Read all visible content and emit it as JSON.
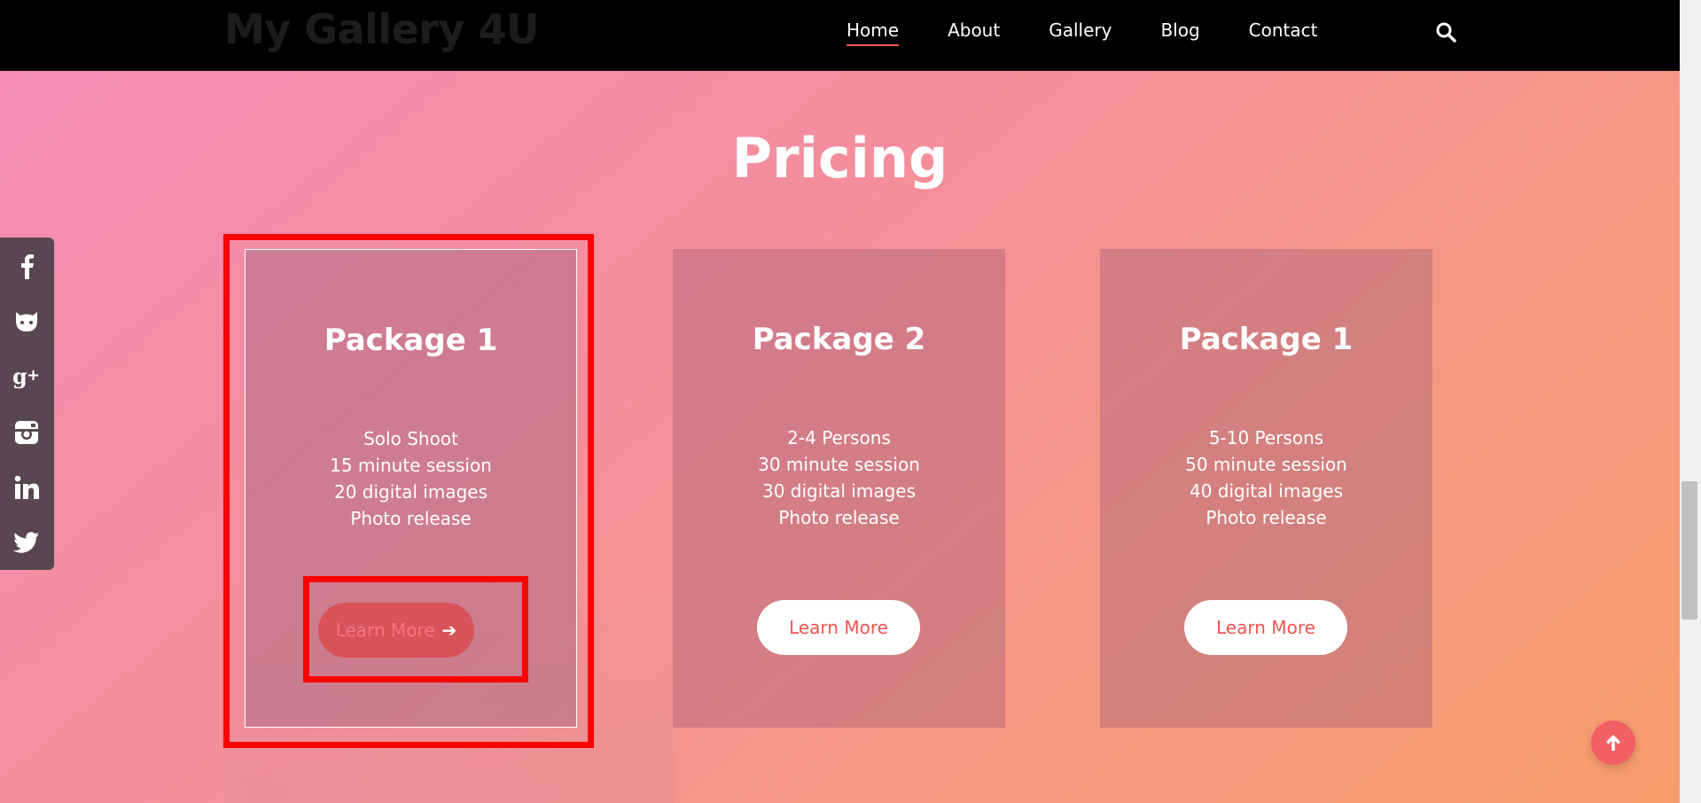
{
  "header": {
    "logo": "My Gallery 4U",
    "nav": [
      {
        "label": "Home",
        "active": true
      },
      {
        "label": "About"
      },
      {
        "label": "Gallery"
      },
      {
        "label": "Blog"
      },
      {
        "label": "Contact"
      }
    ],
    "search_icon": "search-icon"
  },
  "section": {
    "title": "Pricing"
  },
  "social": [
    {
      "icon": "facebook-icon"
    },
    {
      "icon": "github-icon"
    },
    {
      "icon": "google-plus-icon"
    },
    {
      "icon": "instagram-icon"
    },
    {
      "icon": "linkedin-icon"
    },
    {
      "icon": "twitter-icon"
    }
  ],
  "cards": [
    {
      "title": "Package 1",
      "features": [
        "Solo Shoot",
        "15 minute session",
        "20 digital images",
        "Photo release"
      ],
      "button": "Learn More"
    },
    {
      "title": "Package 2",
      "features": [
        "2-4 Persons",
        "30 minute session",
        "30 digital images",
        "Photo release"
      ],
      "button": "Learn More"
    },
    {
      "title": "Package 1",
      "features": [
        "5-10 Persons",
        "50 minute session",
        "40 digital images",
        "Photo release"
      ],
      "button": "Learn More"
    }
  ],
  "colors": {
    "accent": "#f0544f",
    "highlight": "#ff0000",
    "header_bg": "#000000"
  }
}
